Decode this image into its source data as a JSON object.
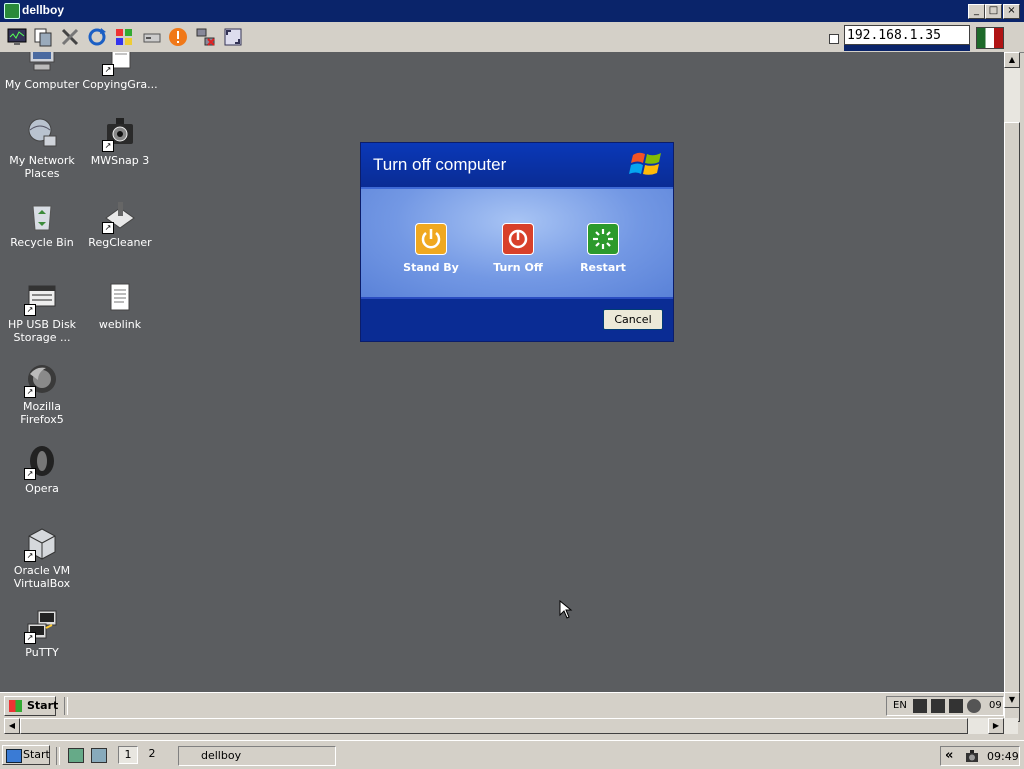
{
  "window": {
    "title": "dellboy"
  },
  "toolbar": {
    "icons": [
      "monitor-icon",
      "copy-icon",
      "tools-icon",
      "refresh-icon",
      "windows-flag-icon",
      "drive-icon",
      "alert-icon",
      "network-icon",
      "fullscreen-icon"
    ],
    "host_ip": "192.168.1.35"
  },
  "desktop_icons": [
    {
      "label": "My Computer",
      "icon": "computer-icon"
    },
    {
      "label": "CopyingGra...",
      "icon": "document-icon"
    },
    {
      "label": "My Network Places",
      "icon": "network-places-icon"
    },
    {
      "label": "MWSnap 3",
      "icon": "camera-icon"
    },
    {
      "label": "Recycle Bin",
      "icon": "recycle-bin-icon"
    },
    {
      "label": "RegCleaner",
      "icon": "regcleaner-icon"
    },
    {
      "label": "HP USB Disk Storage ...",
      "icon": "usb-disk-icon"
    },
    {
      "label": "weblink",
      "icon": "text-file-icon"
    },
    {
      "label": "Mozilla Firefox5",
      "icon": "firefox-icon"
    },
    {
      "label": "Opera",
      "icon": "opera-icon"
    },
    {
      "label": "Oracle VM VirtualBox",
      "icon": "virtualbox-icon"
    },
    {
      "label": "PuTTY",
      "icon": "putty-icon"
    }
  ],
  "dialog": {
    "title": "Turn off computer",
    "standby_label": "Stand By",
    "turnoff_label": "Turn Off",
    "restart_label": "Restart",
    "cancel_label": "Cancel",
    "colors": {
      "header": "#0a38b8",
      "standby": "#f0a820",
      "turnoff": "#d8402a",
      "restart": "#2c9a2c"
    }
  },
  "remote_taskbar": {
    "start_label": "Start",
    "lang": "EN",
    "time": "09"
  },
  "host_taskbar": {
    "start_label": "Start",
    "workspace_1": "1",
    "workspace_2": "2",
    "task_label": "dellboy",
    "chevron": "«",
    "time": "09:49"
  }
}
